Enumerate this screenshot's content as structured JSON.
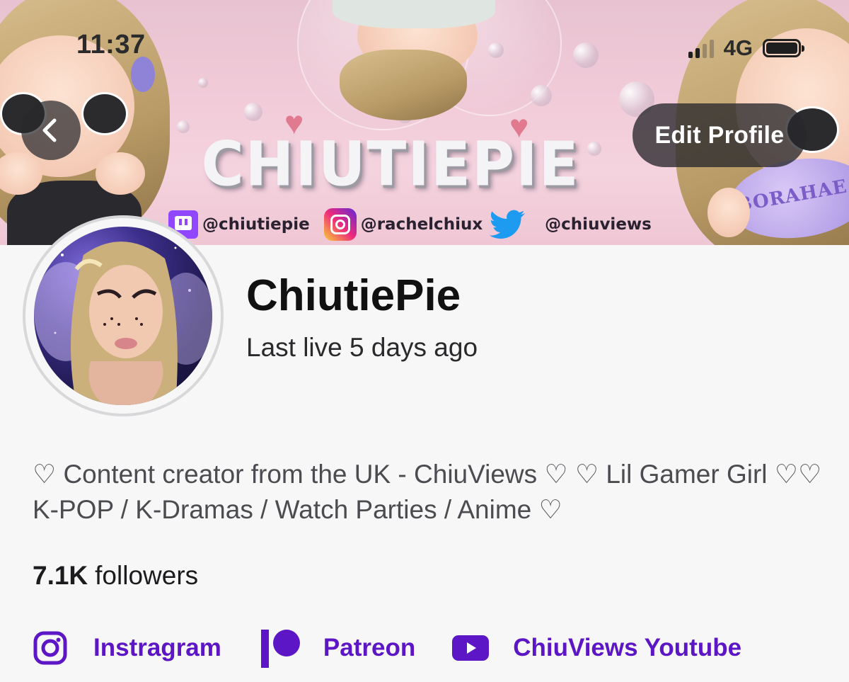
{
  "status_bar": {
    "time": "11:37",
    "network": "4G"
  },
  "banner": {
    "title": "CHIUTIEPIE",
    "socials": [
      {
        "icon": "twitch-icon",
        "handle": "@chiutiepie"
      },
      {
        "icon": "instagram-icon",
        "handle": "@rachelchiux"
      },
      {
        "icon": "twitter-icon",
        "handle": "@chiuviews"
      }
    ],
    "heart_text": "BORAHAE"
  },
  "header": {
    "back_icon": "chevron-left-icon",
    "edit_profile_label": "Edit Profile"
  },
  "profile": {
    "name": "ChiutiePie",
    "last_live": "Last live 5 days ago",
    "bio": "♡ Content creator from the UK - ChiuViews ♡ ♡ Lil Gamer Girl  ♡♡ K-POP /  K-Dramas / Watch Parties / Anime ♡",
    "followers_count": "7.1K",
    "followers_label": "followers"
  },
  "links": [
    {
      "icon": "instagram-icon",
      "label": "Instragram"
    },
    {
      "icon": "patreon-icon",
      "label": "Patreon"
    },
    {
      "icon": "youtube-icon",
      "label": "ChiuViews Youtube"
    }
  ],
  "colors": {
    "accent": "#5c16c5",
    "banner_bg": "#f1cbd8",
    "page_bg": "#f7f7f8"
  }
}
